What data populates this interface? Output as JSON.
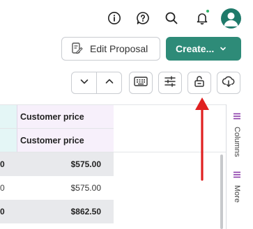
{
  "topbar": {
    "icons": [
      "info-icon",
      "help-chat-icon",
      "search-icon",
      "bell-icon",
      "user-avatar"
    ]
  },
  "actions": {
    "edit_label": "Edit Proposal",
    "create_label": "Create..."
  },
  "toolbar": {
    "buttons": [
      "chevron-down-icon",
      "chevron-up-icon",
      "keyboard-icon",
      "sliders-icon",
      "unlock-icon",
      "download-cloud-icon"
    ]
  },
  "grid": {
    "header_rows": [
      {
        "right": "Customer price"
      },
      {
        "right": "Customer price"
      }
    ],
    "rows": [
      {
        "left": "0",
        "right": "$575.00",
        "bold": true,
        "shaded": true
      },
      {
        "left": "0",
        "right": "$575.00",
        "bold": false,
        "shaded": false
      },
      {
        "left": "0",
        "right": "$862.50",
        "bold": true,
        "shaded": true
      }
    ]
  },
  "side_panel": {
    "tabs": [
      "Columns",
      "More"
    ]
  },
  "colors": {
    "accent": "#2e8b78",
    "arrow": "#e02020",
    "header_cyan": "#e4f6f6",
    "header_lilac": "#f7f0fb",
    "row_shaded": "#e8e9ec"
  }
}
